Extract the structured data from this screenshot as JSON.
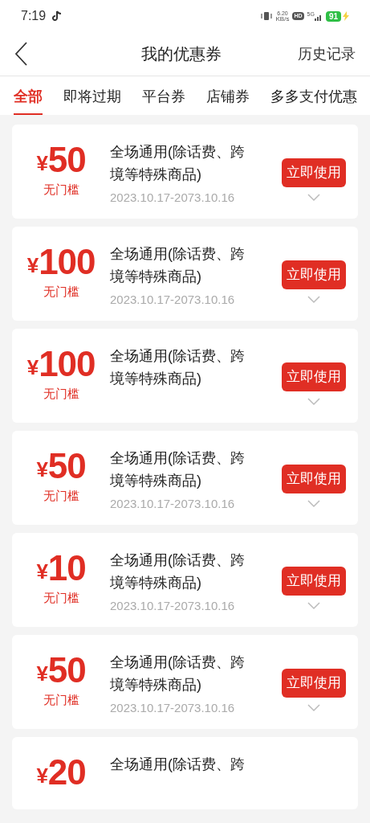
{
  "status_bar": {
    "time": "7:19",
    "speed_value": "6.20",
    "speed_unit": "KB/s",
    "hd": "HD",
    "network": "5G",
    "battery": "91",
    "charging": true
  },
  "header": {
    "title": "我的优惠券",
    "action": "历史记录"
  },
  "tabs": [
    {
      "label": "全部",
      "selected": true
    },
    {
      "label": "即将过期",
      "selected": false
    },
    {
      "label": "平台券",
      "selected": false
    },
    {
      "label": "店铺券",
      "selected": false
    },
    {
      "label": "多多支付优惠",
      "selected": false
    }
  ],
  "coupons": [
    {
      "currency": "¥",
      "amount": "50",
      "condition": "无门槛",
      "title_lines": [
        "全场通用(除话费、跨",
        "境等特殊商品)"
      ],
      "validity": "2023.10.17-2073.10.16",
      "button": "立即使用"
    },
    {
      "currency": "¥",
      "amount": "100",
      "condition": "无门槛",
      "title_lines": [
        "全场通用(除话费、跨",
        "境等特殊商品)"
      ],
      "validity": "2023.10.17-2073.10.16",
      "button": "立即使用"
    },
    {
      "currency": "¥",
      "amount": "100",
      "condition": "无门槛",
      "title_lines": [
        "全场通用(除话费、跨",
        "境等特殊商品)"
      ],
      "button": "立即使用"
    },
    {
      "currency": "¥",
      "amount": "50",
      "condition": "无门槛",
      "title_lines": [
        "全场通用(除话费、跨",
        "境等特殊商品)"
      ],
      "validity": "2023.10.17-2073.10.16",
      "button": "立即使用"
    },
    {
      "currency": "¥",
      "amount": "10",
      "condition": "无门槛",
      "title_lines": [
        "全场通用(除话费、跨",
        "境等特殊商品)"
      ],
      "validity": "2023.10.17-2073.10.16",
      "button": "立即使用"
    },
    {
      "currency": "¥",
      "amount": "50",
      "condition": "无门槛",
      "title_lines": [
        "全场通用(除话费、跨",
        "境等特殊商品)"
      ],
      "validity": "2023.10.17-2073.10.16",
      "button": "立即使用"
    },
    {
      "currency": "¥",
      "amount": "20",
      "title_lines": [
        "全场通用(除话费、跨"
      ]
    }
  ]
}
